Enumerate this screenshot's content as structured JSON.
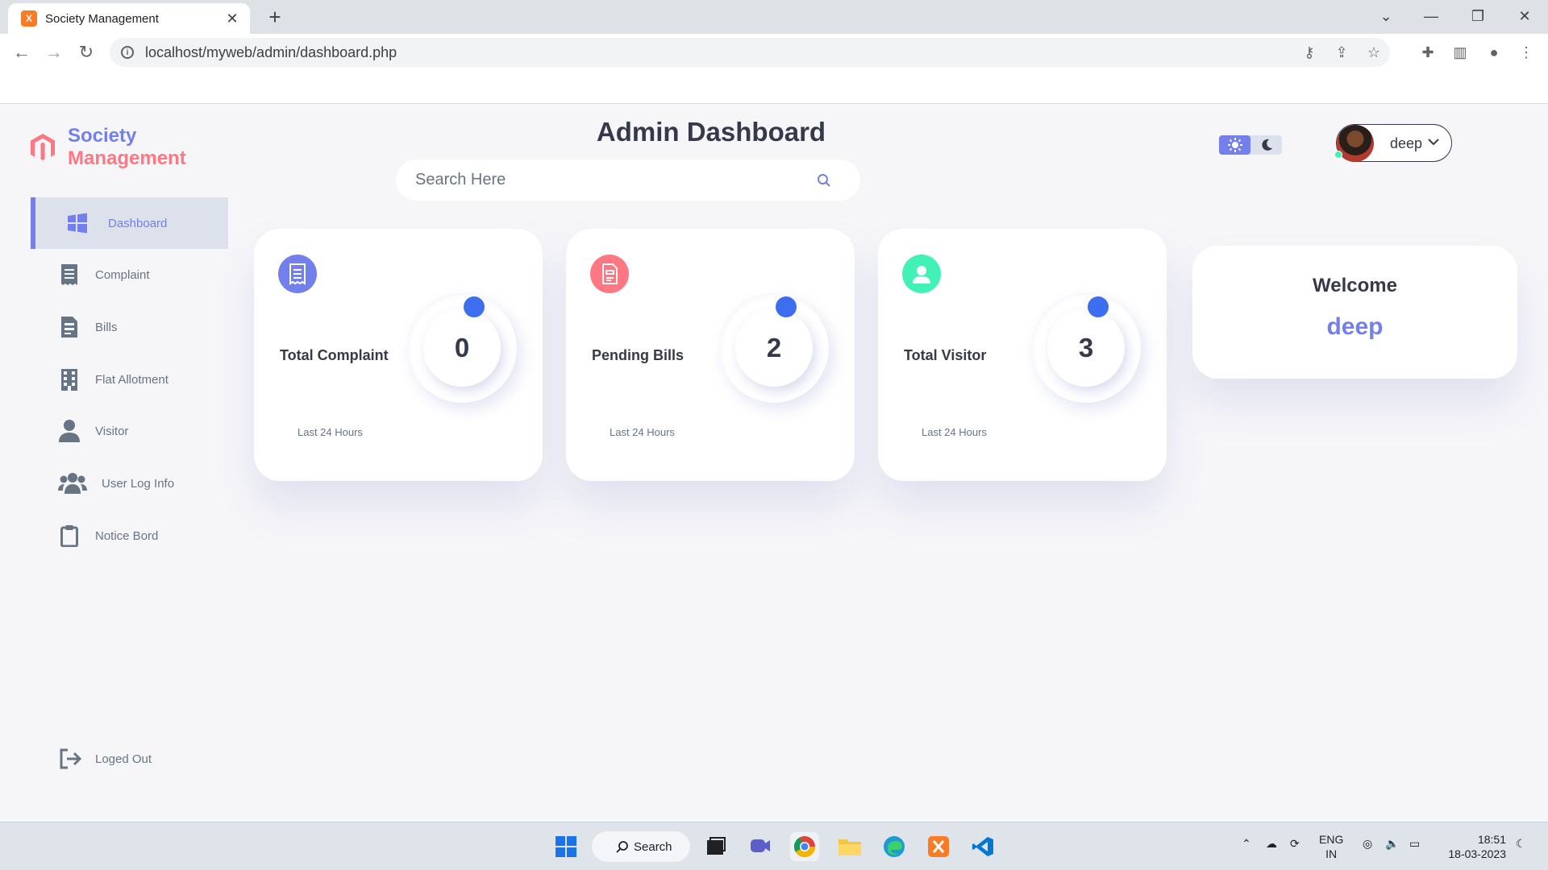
{
  "browser": {
    "tab_title": "Society Management",
    "tab_favicon_letter": "X",
    "url": "localhost/myweb/admin/dashboard.php"
  },
  "brand": {
    "line1": "Society",
    "line2": "Management",
    "color_primary": "#7380ec",
    "color_secondary": "#ff7782"
  },
  "sidebar": {
    "items": [
      {
        "label": "Dashboard",
        "icon": "windows-grid-icon",
        "active": true
      },
      {
        "label": "Complaint",
        "icon": "receipt-icon",
        "active": false
      },
      {
        "label": "Bills",
        "icon": "bill-icon",
        "active": false
      },
      {
        "label": "Flat Allotment",
        "icon": "building-icon",
        "active": false
      },
      {
        "label": "Visitor",
        "icon": "person-icon",
        "active": false
      },
      {
        "label": "User Log Info",
        "icon": "users-icon",
        "active": false
      },
      {
        "label": "Notice Bord",
        "icon": "clipboard-icon",
        "active": false
      }
    ],
    "logout_label": "Loged Out"
  },
  "header": {
    "title": "Admin Dashboard",
    "search_placeholder": "Search Here"
  },
  "profile": {
    "name": "deep"
  },
  "cards": [
    {
      "label": "Total Complaint",
      "value": "0",
      "sub": "Last 24 Hours",
      "icon": "receipt-icon",
      "color": "#7380ec"
    },
    {
      "label": "Pending Bills",
      "value": "2",
      "sub": "Last 24 Hours",
      "icon": "bill-icon",
      "color": "#ff7782"
    },
    {
      "label": "Total Visitor",
      "value": "3",
      "sub": "Last 24 Hours",
      "icon": "person-circle-icon",
      "color": "#41f1b6"
    }
  ],
  "welcome": {
    "title": "Welcome",
    "name": "deep"
  },
  "taskbar": {
    "search_label": "Search",
    "lang_line1": "ENG",
    "lang_line2": "IN",
    "time": "18:51",
    "date": "18-03-2023"
  }
}
